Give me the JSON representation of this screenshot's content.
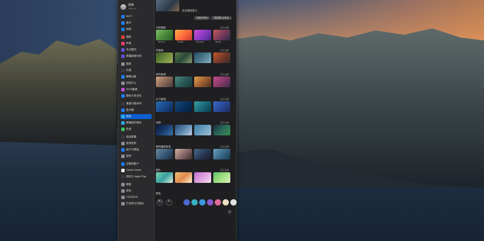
{
  "user": {
    "name": "原来",
    "subtitle": "Apple ID"
  },
  "sidebar": {
    "items": [
      {
        "label": "Wi-Fi",
        "color": "#1e7cf2",
        "icon": "wifi-icon"
      },
      {
        "label": "蓝牙",
        "color": "#1e7cf2",
        "icon": "bluetooth-icon"
      },
      {
        "label": "网络",
        "color": "#1e7cf2",
        "icon": "network-icon"
      },
      {
        "label": "通知",
        "color": "#ef3f3f",
        "icon": "notification-icon"
      },
      {
        "label": "声音",
        "color": "#ef3f6a",
        "icon": "sound-icon"
      },
      {
        "label": "专注模式",
        "color": "#6a4fd6",
        "icon": "focus-icon"
      },
      {
        "label": "屏幕使用时间",
        "color": "#6a4fd6",
        "icon": "screen-time-icon"
      },
      {
        "label": "通用",
        "color": "#8e8e93",
        "icon": "general-icon"
      },
      {
        "label": "外观",
        "color": "#3a3a3c",
        "icon": "appearance-icon"
      },
      {
        "label": "辅助功能",
        "color": "#1e7cf2",
        "icon": "accessibility-icon"
      },
      {
        "label": "控制中心",
        "color": "#8e8e93",
        "icon": "control-center-icon"
      },
      {
        "label": "Siri与聚焦",
        "color": "#c04fd6",
        "icon": "siri-icon"
      },
      {
        "label": "隐私与安全性",
        "color": "#1e7cf2",
        "icon": "privacy-icon"
      },
      {
        "label": "桌面与程序坞",
        "color": "#3a3a3c",
        "icon": "desktop-dock-icon"
      },
      {
        "label": "显示器",
        "color": "#1e7cf2",
        "icon": "display-icon"
      },
      {
        "label": "墙纸",
        "color": "#2fa8e8",
        "icon": "wallpaper-icon",
        "selected": true
      },
      {
        "label": "屏幕保护程序",
        "color": "#2fa8e8",
        "icon": "screensaver-icon"
      },
      {
        "label": "电池",
        "color": "#3cc25a",
        "icon": "battery-icon"
      },
      {
        "label": "锁定屏幕",
        "color": "#3a3a3c",
        "icon": "lock-screen-icon"
      },
      {
        "label": "登录密码",
        "color": "#8e8e93",
        "icon": "login-password-icon"
      },
      {
        "label": "用户与群组",
        "color": "#1e7cf2",
        "icon": "users-icon"
      },
      {
        "label": "密码",
        "color": "#8e8e93",
        "icon": "passwords-icon"
      },
      {
        "label": "互联网账户",
        "color": "#1e7cf2",
        "icon": "internet-accounts-icon"
      },
      {
        "label": "Game Center",
        "color": "#e8e8e8",
        "icon": "game-center-icon"
      },
      {
        "label": "钱包与 Apple Pay",
        "color": "#3a3a3c",
        "icon": "wallet-icon"
      },
      {
        "label": "键盘",
        "color": "#8e8e93",
        "icon": "keyboard-icon"
      },
      {
        "label": "鼠标",
        "color": "#8e8e93",
        "icon": "mouse-icon"
      },
      {
        "label": "CD与DVD",
        "color": "#8e8e93",
        "icon": "cd-dvd-icon"
      },
      {
        "label": "打印机与扫描仪",
        "color": "#8e8e93",
        "icon": "printers-icon"
      }
    ]
  },
  "content": {
    "current_caption": "自定墙纸显示",
    "buttons": [
      "添加文件夹",
      "添加照片文件夹"
    ],
    "sections": [
      {
        "title": "动态墙纸",
        "more": "显示全部",
        "thumbs": [
          {
            "caption": "Sonoma",
            "colors": [
              "#7fbf6a",
              "#4a8a3a",
              "#2e5e2a"
            ]
          },
          {
            "caption": "macOS",
            "colors": [
              "#ffb347",
              "#ff6a3d",
              "#c43a2e"
            ]
          },
          {
            "caption": "Monterey",
            "colors": [
              "#d14fd6",
              "#8a3ac4",
              "#4a2a8a"
            ]
          },
          {
            "caption": "Big Sur",
            "colors": [
              "#c85a5a",
              "#7a3a5a",
              "#2a2a4a"
            ]
          }
        ]
      },
      {
        "title": "风景画",
        "more": "显示全部",
        "thumbs": [
          {
            "caption": "",
            "colors": [
              "#3a5a2a",
              "#6a8a3a",
              "#a0b060"
            ]
          },
          {
            "caption": "",
            "colors": [
              "#5a7a4a",
              "#2a4a3a",
              "#8a9a6a"
            ]
          },
          {
            "caption": "",
            "colors": [
              "#2a4a6a",
              "#4a7a8a",
              "#8ab0c0"
            ]
          },
          {
            "caption": "",
            "colors": [
              "#c05a2a",
              "#7a3a2a",
              "#3a2a2a"
            ]
          }
        ]
      },
      {
        "title": "城市景观",
        "more": "显示全部",
        "thumbs": [
          {
            "caption": "",
            "colors": [
              "#d0a080",
              "#8a6a5a",
              "#4a3a3a"
            ]
          },
          {
            "caption": "",
            "colors": [
              "#4a8a7a",
              "#2a5a5a",
              "#1a3a3a"
            ]
          },
          {
            "caption": "",
            "colors": [
              "#e0a050",
              "#a06030",
              "#4a3020"
            ]
          },
          {
            "caption": "",
            "colors": [
              "#c04a8a",
              "#8a3a6a",
              "#3a2a4a"
            ]
          }
        ]
      },
      {
        "title": "水下景观",
        "more": "显示全部",
        "thumbs": [
          {
            "caption": "",
            "colors": [
              "#2a6ab0",
              "#1a4a8a",
              "#0a2a5a"
            ]
          },
          {
            "caption": "",
            "colors": [
              "#1a4a7a",
              "#0a3060",
              "#05203a"
            ]
          },
          {
            "caption": "",
            "colors": [
              "#3aa0a0",
              "#1a6a7a",
              "#0a3a4a"
            ]
          },
          {
            "caption": "",
            "colors": [
              "#3a6ac0",
              "#2a4a9a",
              "#1a2a5a"
            ]
          }
        ]
      },
      {
        "title": "地球",
        "more": "显示全部",
        "thumbs": [
          {
            "caption": "",
            "colors": [
              "#0a1a3a",
              "#1a3a6a",
              "#3a7ab0"
            ]
          },
          {
            "caption": "",
            "colors": [
              "#2a4a7a",
              "#5a8ab0",
              "#c0d0e0"
            ]
          },
          {
            "caption": "",
            "colors": [
              "#3a7aa0",
              "#6aa0c0",
              "#a0c0d0"
            ]
          },
          {
            "caption": "",
            "colors": [
              "#1a2a3a",
              "#2a6a5a",
              "#3a8a4a"
            ]
          }
        ]
      },
      {
        "title": "随机播放航拍",
        "more": "显示全部",
        "thumbs": [
          {
            "caption": "",
            "colors": [
              "#6a8aa0",
              "#3a5a7a",
              "#1a2a3a"
            ]
          },
          {
            "caption": "",
            "colors": [
              "#d0b0a0",
              "#8a6a6a",
              "#3a2a2a"
            ]
          },
          {
            "caption": "",
            "colors": [
              "#4a6a8a",
              "#2a3a5a",
              "#1a1a2a"
            ]
          },
          {
            "caption": "",
            "colors": [
              "#6aa0c0",
              "#3a6a8a",
              "#1a3a4a"
            ]
          }
        ]
      },
      {
        "title": "图片",
        "more": "显示全部",
        "thumbs": [
          {
            "caption": "",
            "colors": [
              "#7ad0b0",
              "#3aa0a0",
              "#e0f0e0"
            ]
          },
          {
            "caption": "",
            "colors": [
              "#f0c070",
              "#e08a50",
              "#fff0d0"
            ]
          },
          {
            "caption": "",
            "colors": [
              "#c070d0",
              "#e0a0e0",
              "#f0e0f0"
            ]
          },
          {
            "caption": "",
            "colors": [
              "#60c070",
              "#a0e080",
              "#e0f0c0"
            ]
          }
        ]
      }
    ],
    "colors_title": "颜色",
    "colors": [
      "#1a1a1a",
      "#4a6ad0",
      "#3ab0c0",
      "#3a9ae0",
      "#8a5ad0",
      "#e06a9a",
      "#f0e0c0",
      "#e0e0e0"
    ],
    "help_label": "?"
  }
}
